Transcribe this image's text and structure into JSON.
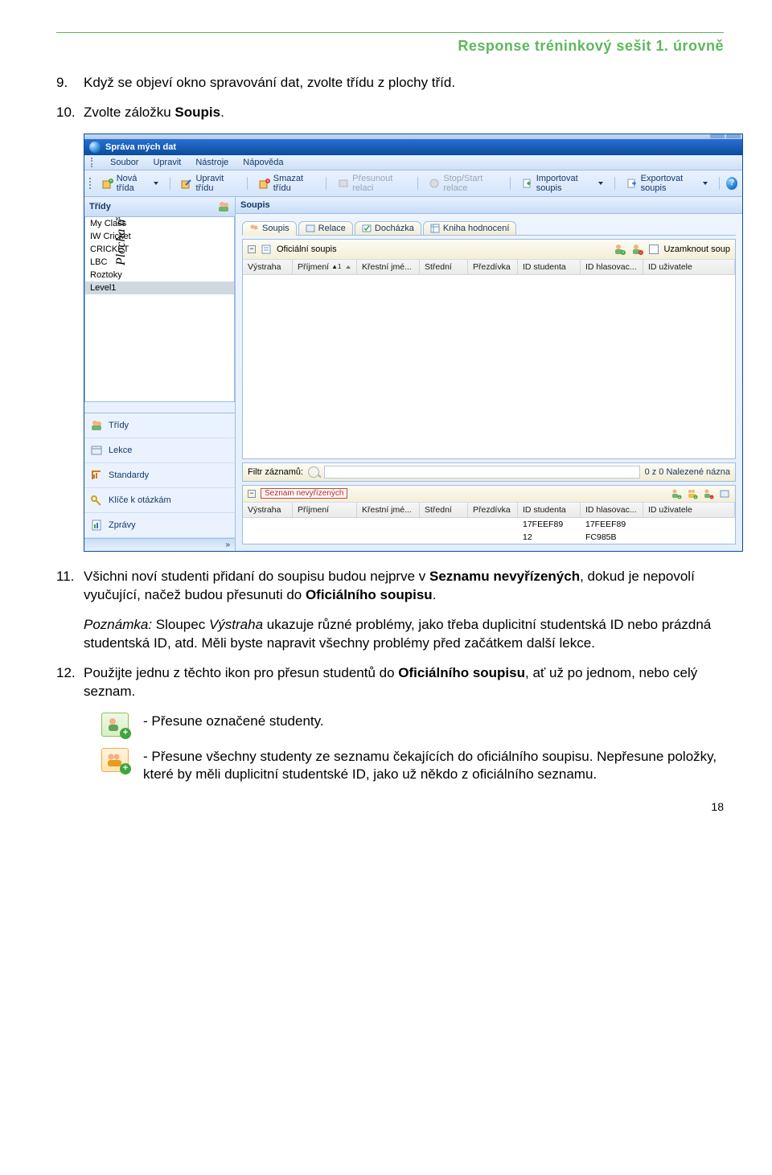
{
  "doc": {
    "header": "Response tréninkový sešit 1. úrovně",
    "page_number": "18",
    "step9": "Když se objeví okno spravování dat, zvolte třídu z plochy tříd.",
    "step10_pre": "Zvolte záložku ",
    "step10_b": "Soupis",
    "step10_post": ".",
    "step11_a": "Všichni noví studenti přidaní do soupisu budou nejprve v ",
    "step11_b": "Seznamu nevyřízených",
    "step11_c": ", dokud je nepovolí vyučující, načež budou přesunuti do ",
    "step11_d": "Oficiálního soupisu",
    "step11_e": ".",
    "note_label": "Poznámka:",
    "note_pre": " Sloupec ",
    "note_em": "Výstraha",
    "note_post": "  ukazuje různé problémy, jako třeba duplicitní studentská ID nebo prázdná studentská ID, atd.  Měli byste napravit všechny problémy před začátkem další lekce.",
    "step12_a": "Použijte jednu z těchto ikon pro přesun studentů do ",
    "step12_b": "Oficiálního soupisu",
    "step12_c": ", ať už po jednom, nebo celý seznam.",
    "icon1": "- Přesune označené studenty.",
    "icon2": "- Přesune všechny studenty ze seznamu čekajících do oficiálního soupisu. Nepřesune položky, které by měli duplicitní studentské ID, jako už někdo z oficiálního seznamu."
  },
  "app": {
    "title": "Správa mých dat",
    "menu": [
      "Soubor",
      "Upravit",
      "Nástroje",
      "Nápověda"
    ],
    "toolbar": {
      "new": "Nová třída",
      "edit": "Upravit třídu",
      "delete": "Smazat třídu",
      "move": "Přesunout relaci",
      "stop": "Stop/Start relace",
      "import": "Importovat soupis",
      "export": "Exportovat soupis"
    },
    "left": {
      "header": "Třídy",
      "classes": [
        "My Class",
        "IW Cricket",
        "CRICKET",
        "LBC",
        "Roztoky",
        "Level1"
      ],
      "vertical_label": "Plocha tříd",
      "nav": [
        "Třídy",
        "Lekce",
        "Standardy",
        "Klíče k otázkám",
        "Zprávy"
      ],
      "chevron": "»"
    },
    "right": {
      "pane_header": "Soupis",
      "tabs": [
        "Soupis",
        "Relace",
        "Docházka",
        "Kniha hodnocení"
      ],
      "roster_label": "Oficiální soupis",
      "lock_label": "Uzamknout soup",
      "columns": [
        "Výstraha",
        "Příjmení",
        "Křestní jmé...",
        "Střední",
        "Přezdívka",
        "ID studenta",
        "ID hlasovac...",
        "ID uživatele"
      ],
      "filter_label": "Filtr záznamů:",
      "filter_found": "0 z 0 Nalezené názna",
      "pending_label": "Seznam nevyřízených",
      "pending_columns": [
        "Výstraha",
        "Příjmení",
        "Křestní jmé...",
        "Střední",
        "Přezdívka",
        "ID studenta",
        "ID hlasovac...",
        "ID uživatele"
      ],
      "pending_rows": [
        {
          "sid": "17FEEF89",
          "vote": "17FEEF89"
        },
        {
          "sid": "12",
          "vote": "FC985B"
        }
      ]
    }
  }
}
